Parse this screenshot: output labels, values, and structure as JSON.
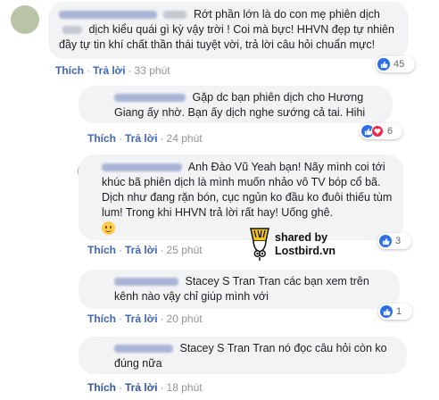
{
  "comments": [
    {
      "text": "Rớt phần lớn là do con mẹ phiên dịch",
      "text_cont": "dịch kiểu quái gì kỳ vậy trời ! Coi mà bực! HHVN đẹp tự nhiên đầy tự tin khí chất thần thái tuyệt vời, trả lời câu hỏi chuẩn mực!",
      "like_label": "Thích",
      "reply_label": "Trả lời",
      "time": "33 phút",
      "reaction_count": "45"
    },
    {
      "text": "Gặp dc bạn phiên dịch cho Hương Giang ấy nhờ. Bạn ấy dịch nghe sướng cả tai. Hihi",
      "like_label": "Thích",
      "reply_label": "Trả lời",
      "time": "24 phút",
      "reaction_count": "6"
    },
    {
      "text": "Anh Đào Vũ Yeah bạn! Nãy mình coi tới khúc bã phiên dịch là mình muốn nhảo vô TV bóp cổ bã. Dịch như đang rặn bón, cục ngủn ko đầu ko đuôi thiếu tùm lum! Trong khi HHVN trả lời rất hay! Uống ghê.",
      "like_label": "Thích",
      "reply_label": "Trả lời",
      "time": "25 phút",
      "reaction_count": "3"
    },
    {
      "text": "Stacey S Tran Tran các bạn xem trên kênh nào vậy chỉ giúp mình với",
      "like_label": "Thích",
      "reply_label": "Trả lời",
      "time": "20 phút",
      "reaction_count": "1"
    },
    {
      "text": "Stacey S Tran Tran nó đọc câu hỏi còn ko đúng nữa",
      "like_label": "Thích",
      "reply_label": "Trả lời",
      "time": "18 phút"
    }
  ],
  "watermark": {
    "line1": "shared by",
    "line2": "Lostbird.vn"
  },
  "icons": {
    "like": "like-icon",
    "heart": "heart-icon",
    "emoji": "sad-smile-emoji-icon",
    "logo": "lostbird-logo-icon"
  },
  "colors": {
    "link": "#4267b2",
    "like_blue": "#2e6fe8",
    "heart_red": "#f0284a",
    "bubble": "#f2f3f5"
  }
}
